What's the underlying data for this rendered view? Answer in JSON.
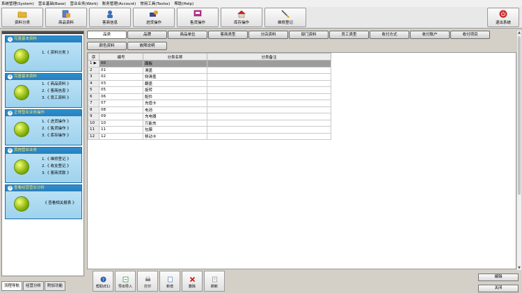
{
  "menu": [
    "系统管理(System)",
    "营业基础(Base)",
    "营业业务(Work)",
    "账务管理(Account)",
    "常用工具(Toolsx)",
    "帮助(Help)"
  ],
  "toolbar": [
    {
      "label": "资料分类",
      "icon": "folder-icon"
    },
    {
      "label": "商品资料",
      "icon": "product-icon"
    },
    {
      "label": "客商信息",
      "icon": "customer-icon"
    },
    {
      "label": "进货操作",
      "icon": "purchase-icon"
    },
    {
      "label": "售货操作",
      "icon": "sales-icon"
    },
    {
      "label": "库存操作",
      "icon": "warehouse-icon"
    },
    {
      "label": "维修登记",
      "icon": "repair-icon"
    }
  ],
  "exit_label": "退出系统",
  "nav": [
    {
      "num": "①",
      "title": "完善基本资料",
      "links": [
        "1.《 资料分类 》"
      ]
    },
    {
      "num": "②",
      "title": "完善基本资料",
      "links": [
        "1.《 商品资料 》",
        "2.《 客商信息 》",
        "3.《 员工资料 》"
      ]
    },
    {
      "num": "③",
      "title": "正常营业业务操作",
      "links": [
        "1.《 进货操作 》",
        "2.《 售货操作 》",
        "3.《 库存操作 》"
      ]
    },
    {
      "num": "④",
      "title": "其他营业业务",
      "links": [
        "1.《 维修登记 》",
        "2.《 收支登记 》",
        "3.《 客商货款 》"
      ]
    },
    {
      "num": "⑤",
      "title": "查看经营营业分析",
      "links": [
        "《 查看相关报表 》"
      ]
    }
  ],
  "left_tabs": [
    {
      "label": "流程导航",
      "active": true
    },
    {
      "label": "经营分析",
      "active": false
    },
    {
      "label": "附加功能",
      "active": false
    }
  ],
  "tabs_row1": [
    {
      "label": "品类",
      "active": true
    },
    {
      "label": "品牌",
      "active": false
    },
    {
      "label": "商品单位",
      "active": false
    },
    {
      "label": "客商类型",
      "active": false
    },
    {
      "label": "分店资料",
      "active": false
    },
    {
      "label": "部门资料",
      "active": false
    },
    {
      "label": "员工类型",
      "active": false
    },
    {
      "label": "收付方式",
      "active": false
    },
    {
      "label": "收付账户",
      "active": false
    },
    {
      "label": "收付项目",
      "active": false
    }
  ],
  "tabs_row2": [
    {
      "label": "颜色资料",
      "active": false
    },
    {
      "label": "故障说明",
      "active": false
    }
  ],
  "grid": {
    "headers": [
      "序",
      "编号",
      "分类名称",
      "分类备注"
    ],
    "current_marker": "▶",
    "rows": [
      {
        "n": "1",
        "code": "00",
        "name": "面板",
        "note": "",
        "selected": true
      },
      {
        "n": "2",
        "code": "01",
        "name": "滑盖",
        "note": ""
      },
      {
        "n": "3",
        "code": "02",
        "name": "侧滑盖",
        "note": ""
      },
      {
        "n": "4",
        "code": "03",
        "name": "翻盖",
        "note": ""
      },
      {
        "n": "5",
        "code": "05",
        "name": "旋转",
        "note": ""
      },
      {
        "n": "6",
        "code": "06",
        "name": "配件",
        "note": ""
      },
      {
        "n": "7",
        "code": "07",
        "name": "充值卡",
        "note": ""
      },
      {
        "n": "8",
        "code": "08",
        "name": "电池",
        "note": ""
      },
      {
        "n": "9",
        "code": "09",
        "name": "充电器",
        "note": ""
      },
      {
        "n": "10",
        "code": "10",
        "name": "万能充",
        "note": ""
      },
      {
        "n": "11",
        "code": "11",
        "name": "包膜",
        "note": ""
      },
      {
        "n": "12",
        "code": "12",
        "name": "移动卡",
        "note": ""
      }
    ]
  },
  "bottom_buttons": [
    {
      "label": "帮助(E1)",
      "icon": "help-icon"
    },
    {
      "label": "导出导入",
      "icon": "export-icon"
    },
    {
      "label": "打印",
      "icon": "print-icon"
    },
    {
      "label": "新增",
      "icon": "new-icon"
    },
    {
      "label": "删除",
      "icon": "delete-icon"
    },
    {
      "label": "刷新",
      "icon": "refresh-icon"
    }
  ],
  "edit_label": "编辑",
  "close_label": "关闭",
  "colors": {
    "nav_title": "#2a7fbd",
    "nav_text": "#ffe45a",
    "selected_row": "#9c9c9c",
    "delete_icon": "#d01010"
  }
}
